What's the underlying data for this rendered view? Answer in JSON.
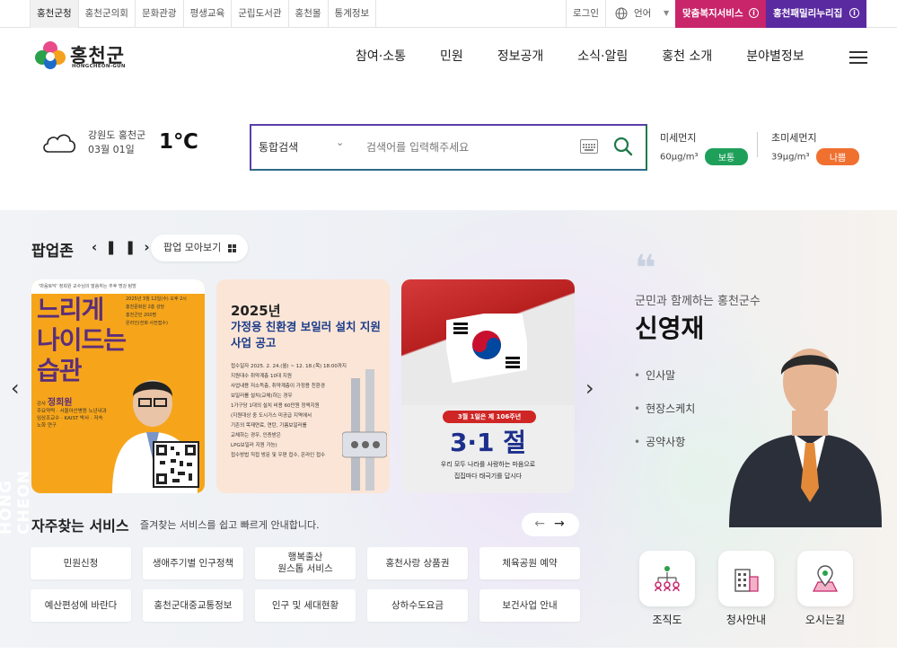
{
  "topbar": {
    "tabs": [
      "홍천군청",
      "홍천군의회",
      "문화관광",
      "평생교육",
      "군립도서관",
      "홍천몰",
      "통계정보"
    ],
    "login": "로그인",
    "language": "언어",
    "service1": "맞춤복지서비스",
    "service2": "홍천패밀리누리집",
    "service1_color": "#c8256a",
    "service2_color": "#5a2aa0"
  },
  "header": {
    "logo_ko": "홍천군",
    "logo_en": "HONGCHEON-GUN",
    "nav": [
      "참여·소통",
      "민원",
      "정보공개",
      "소식·알림",
      "홍천 소개",
      "분야별정보"
    ]
  },
  "weather": {
    "location": "강원도 홍천군",
    "date": "03월 01일",
    "temp": "1℃"
  },
  "search": {
    "scope": "통합검색",
    "placeholder": "검색어를 입력해주세요",
    "border_color": "#5a3fa8"
  },
  "dust": {
    "pm10_title": "미세먼지",
    "pm10_value": "60μg/m³",
    "pm10_status": "보통",
    "pm10_color": "#1ea05a",
    "pm25_title": "초미세먼지",
    "pm25_value": "39μg/m³",
    "pm25_status": "나쁨",
    "pm25_color": "#f07030"
  },
  "popup": {
    "title": "팝업존",
    "controls": "‹ ❚❚ ›",
    "view_all": "팝업 모아보기",
    "side_text": "HONG CHEON",
    "card1": {
      "top_line": "'마음토닥' 정희원 교수님의 말씀하는 추후 명강 탐방",
      "headline": "느리게 나이드는 습관",
      "info": [
        "2025년 3월 12일(수) 오후 2시",
        "홍천문화원 2층 강당",
        "홍천군민 200명",
        "온라인(전화·사전접수)"
      ],
      "speaker_label": "강사",
      "speaker": "정희원",
      "speaker_info": "주요약력 · 서울아산병원 노년내과 임상조교수 · KAIST 박사 · 저속노화 연구"
    },
    "card2": {
      "year": "2025년",
      "title": "가정용 친환경 보일러 설치 지원사업 공고",
      "lines": [
        "접수일자 2025. 2. 24.(월) ~ 12. 18.(목) 18:00까지",
        "지원대수 취약계층 10대 지원",
        "사업내용 저소득층, 취약계층이 가정용 친환경",
        "보일러를 설치(교체)하는 경우",
        "1가구당 1대의 설치 비용 60만원 정액지원",
        "(지원대상 중 도시가스 미공급 지역에서",
        "기존의 목재연료, 연탄, 기름보일러를",
        "교체하는 경우, 인증받은",
        "LPG보일러 지원 가능)",
        "접수방법 직접 방문 및 우편 접수, 온라인 접수"
      ]
    },
    "card3": {
      "badge": "3월 1일은 제 106주년",
      "title": "3·1 절",
      "sub1": "우리 모두 나라를 사랑하는 마음으로",
      "sub2": "집집마다 태극기를 답시다"
    }
  },
  "frequent": {
    "title": "자주찾는 서비스",
    "subtitle": "즐겨찾는 서비스를 쉽고 빠르게 안내합니다.",
    "nav": "← →",
    "items": [
      "민원신청",
      "생애주기별 인구정책",
      "행복출산\n원스톱 서비스",
      "홍천사랑 상품권",
      "체육공원 예약",
      "예산편성에 바란다",
      "홍천군대중교통정보",
      "인구 및 세대현황",
      "상하수도요금",
      "보건사업 안내"
    ]
  },
  "mayor": {
    "quote": "❛❛",
    "subtitle": "군민과 함께하는 홍천군수",
    "name": "신영재",
    "links": [
      "인사말",
      "현장스케치",
      "공약사항"
    ]
  },
  "quick": [
    "조직도",
    "청사안내",
    "오시는길"
  ]
}
